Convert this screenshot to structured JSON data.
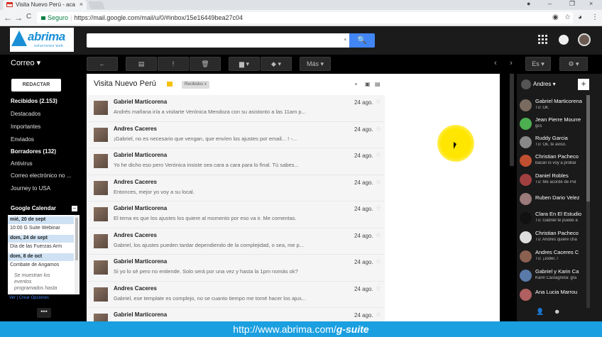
{
  "browser": {
    "tab_title": "Visita Nuevo Perú - aca",
    "tab_close": "×",
    "secure_label": "Seguro",
    "url": "https://mail.google.com/mail/u/0/#inbox/15e16449bea27c04",
    "back": "←",
    "forward": "→",
    "reload": "C",
    "window_controls": [
      "–",
      "❐",
      "×"
    ]
  },
  "logo": {
    "name": "abrima",
    "sub": "soluciones web"
  },
  "search": {
    "placeholder": "",
    "button": "🔍"
  },
  "toolbar": {
    "app_label": "Correo ▾",
    "reply": "←",
    "archive": "▤",
    "spam": "!",
    "delete": "🗑",
    "move": "▆ ▾",
    "labels": "◆ ▾",
    "more": "Más ▾",
    "prev": "‹",
    "next": "›",
    "lang": "Es ▾",
    "settings": "⚙ ▾"
  },
  "sidebar": {
    "compose": "REDACTAR",
    "items": [
      {
        "label": "Recibidos (2.153)",
        "bold": true
      },
      {
        "label": "Destacados",
        "bold": false
      },
      {
        "label": "Importantes",
        "bold": false
      },
      {
        "label": "Enviados",
        "bold": false
      },
      {
        "label": "Borradores (132)",
        "bold": true
      },
      {
        "label": "Antivirus",
        "bold": false
      },
      {
        "label": "Correo electrónico no ...",
        "bold": false
      },
      {
        "label": "Journey to USA",
        "bold": false
      }
    ],
    "calendar": {
      "title": "Google Calendar",
      "minimize": "–",
      "lines": [
        "mié, 20 de sept",
        "10:00  G Suite Webinar",
        "dom, 24 de sept",
        "Día de las Fuerzas Arm",
        "dom, 8 de oct",
        "Combate de Angamos"
      ],
      "note": [
        "Se muestran los",
        "eventos",
        "programados hasta"
      ],
      "links": "Ver | Crear        Opciones"
    },
    "more_button": "•••"
  },
  "thread": {
    "subject": "Visita Nuevo Perú",
    "label_chip": "Recibidos  x",
    "messages": [
      {
        "from": "Gabriel Marticorena",
        "snippet": "Andrés mañana iría a visitarte Verónica Mendoza con su asistonto a las 11am p...",
        "date": "24 ago."
      },
      {
        "from": "Andres Caceres",
        "snippet": "¡Gabriel, no es necesario que vengan, que envíen los ajustes por email... ! -...",
        "date": "24 ago."
      },
      {
        "from": "Gabriel Marticorena",
        "snippet": "Yo he dicho eso pero Verónica insiste sea cara a cara para lo final. Tú sabes...",
        "date": "24 ago."
      },
      {
        "from": "Andres Caceres",
        "snippet": "Entonces, mejor yo voy a su local.",
        "date": "24 ago."
      },
      {
        "from": "Gabriel Marticorena",
        "snippet": "El tema es que los ajustes los quiere al momento por eso va ir. Me comentas.",
        "date": "24 ago."
      },
      {
        "from": "Andres Caceres",
        "snippet": "Gabriel, los ajustes pueden tardar dependiendo de la complejidad, o sea, me p...",
        "date": "24 ago."
      },
      {
        "from": "Gabriel Marticorena",
        "snippet": "Si yo lo sé pero no entiende. Solo será por una vez y hasta la 1pm nomás ok?",
        "date": "24 ago."
      },
      {
        "from": "Andres Caceres",
        "snippet": "Gabriel, ese template es complejo, no se cuanto tiempo me tomé hacer los ajus...",
        "date": "24 ago."
      },
      {
        "from": "Gabriel Marticorena",
        "snippet": "",
        "date": "24 ago."
      }
    ],
    "star": "☆"
  },
  "chat": {
    "me": "Andres ▾",
    "add": "+",
    "contacts": [
      {
        "name": "Gabriel Marticorena",
        "status": "Tú: Ok.",
        "color": "#7a6b60"
      },
      {
        "name": "Jean Pierre Mourre",
        "status": "gcs",
        "color": "#4caf50"
      },
      {
        "name": "Ruddy Garcia",
        "status": "Tú: Ok, te aviso.",
        "color": "#888"
      },
      {
        "name": "Christian Pacheco",
        "status": "bacan lo voy a probar",
        "color": "#c05030"
      },
      {
        "name": "Daniel Robles",
        "status": "Tú: Me acordé de Pul",
        "color": "#a04040"
      },
      {
        "name": "Ruben Dario Velez",
        "status": "",
        "color": "#9a7a7a"
      },
      {
        "name": "Clara En El Estudio",
        "status": "Tú: Gabriel te puede a",
        "color": "#111"
      },
      {
        "name": "Christian Pacheco",
        "status": "Tú: Andres quiere cha",
        "color": "#ddd"
      },
      {
        "name": "Andres Caceres C",
        "status": "Tú: ¡Joder..!",
        "color": "#8a6050"
      },
      {
        "name": "Gabriel y Karin Ca",
        "status": "Karin Castagnola: gra",
        "color": "#5a7aaa"
      },
      {
        "name": "Ana Lucia Marrou",
        "status": "",
        "color": "#b06060"
      }
    ],
    "bottom": [
      "👤",
      "☻"
    ]
  },
  "footer": {
    "prefix": "http://www.abrima.com/",
    "suffix": "g-suite"
  },
  "colors": {
    "accent": "#4285f4",
    "banner": "#1a9fe0",
    "highlight": "#ffe600"
  }
}
